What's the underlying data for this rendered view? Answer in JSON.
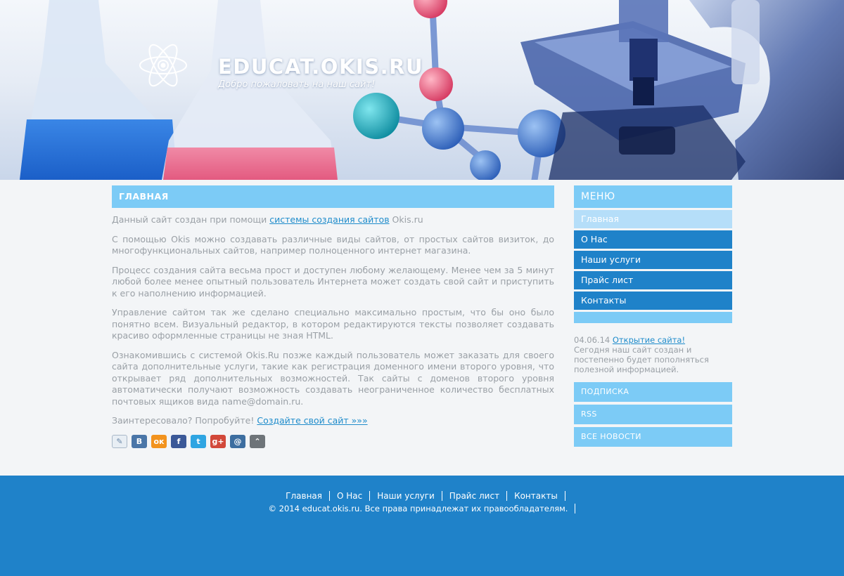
{
  "header": {
    "site_title": "EDUCAT.OKIS.RU",
    "slogan": "Добро пожаловать на наш сайт!"
  },
  "main": {
    "heading": "ГЛАВНАЯ",
    "p1_before": "Данный сайт создан при помощи ",
    "p1_link": "системы создания сайтов",
    "p1_after": " Okis.ru",
    "p2": "С помощью Okis можно создавать различные виды сайтов, от простых сайтов визиток, до многофункциональных сайтов, например полноценного интернет магазина.",
    "p3": "Процесс создания сайта весьма прост и доступен любому желающему. Менее чем за 5 минут любой более менее опытный пользователь Интернета может создать свой сайт и приступить к его наполнению информацией.",
    "p4": "Управление сайтом так же сделано специально максимально простым, что бы оно было понятно всем. Визуальный редактор, в котором редактируются тексты позволяет создавать красиво оформленные страницы не зная HTML.",
    "p5": "Ознакомившись с системой Okis.Ru позже каждый пользователь может заказать для своего сайта дополнительные услуги, такие как регистрация доменного имени второго уровня, что открывает ряд дополнительных возможностей. Так сайты с доменов второго уровня автоматически получают возможность создавать неограниченное количество бесплатных почтовых ящиков вида name@domain.ru.",
    "p6_before": "Заинтересовало? Попробуйте! ",
    "p6_link": "Создайте свой сайт »»»",
    "share": [
      {
        "icon": "livejournal-icon",
        "glyph": "✎",
        "color": "#e8eef4"
      },
      {
        "icon": "vkontakte-icon",
        "glyph": "B",
        "color": "#4a76a8"
      },
      {
        "icon": "odnoklassniki-icon",
        "glyph": "ок",
        "color": "#f2931e"
      },
      {
        "icon": "facebook-icon",
        "glyph": "f",
        "color": "#3b5998"
      },
      {
        "icon": "twitter-icon",
        "glyph": "t",
        "color": "#2fa5e2"
      },
      {
        "icon": "googleplus-icon",
        "glyph": "g+",
        "color": "#d2483a"
      },
      {
        "icon": "mailru-icon",
        "glyph": "@",
        "color": "#3d6ea0"
      },
      {
        "icon": "more-icon",
        "glyph": "⌃",
        "color": "#6e7479"
      }
    ]
  },
  "sidebar": {
    "menu_title": "МЕНЮ",
    "menu": [
      "Главная",
      "О Нас",
      "Наши услуги",
      "Прайс лист",
      "Контакты"
    ],
    "news_date": "04.06.14",
    "news_link": "Открытие сайта!",
    "news_text": "Сегодня наш сайт создан и постепенно будет пополняться полезной информацией.",
    "buttons": [
      "ПОДПИСКА",
      "RSS",
      "ВСЕ НОВОСТИ"
    ]
  },
  "footer": {
    "nav": [
      "Главная",
      "О Нас",
      "Наши услуги",
      "Прайс лист",
      "Контакты"
    ],
    "copyright": "© 2014 educat.okis.ru. Все права принадлежат их правообладателям."
  },
  "colors": {
    "accent_light": "#7ccbf6",
    "accent_dark": "#1f82c9",
    "link": "#1f8ccb",
    "text": "#9aa0a6"
  }
}
